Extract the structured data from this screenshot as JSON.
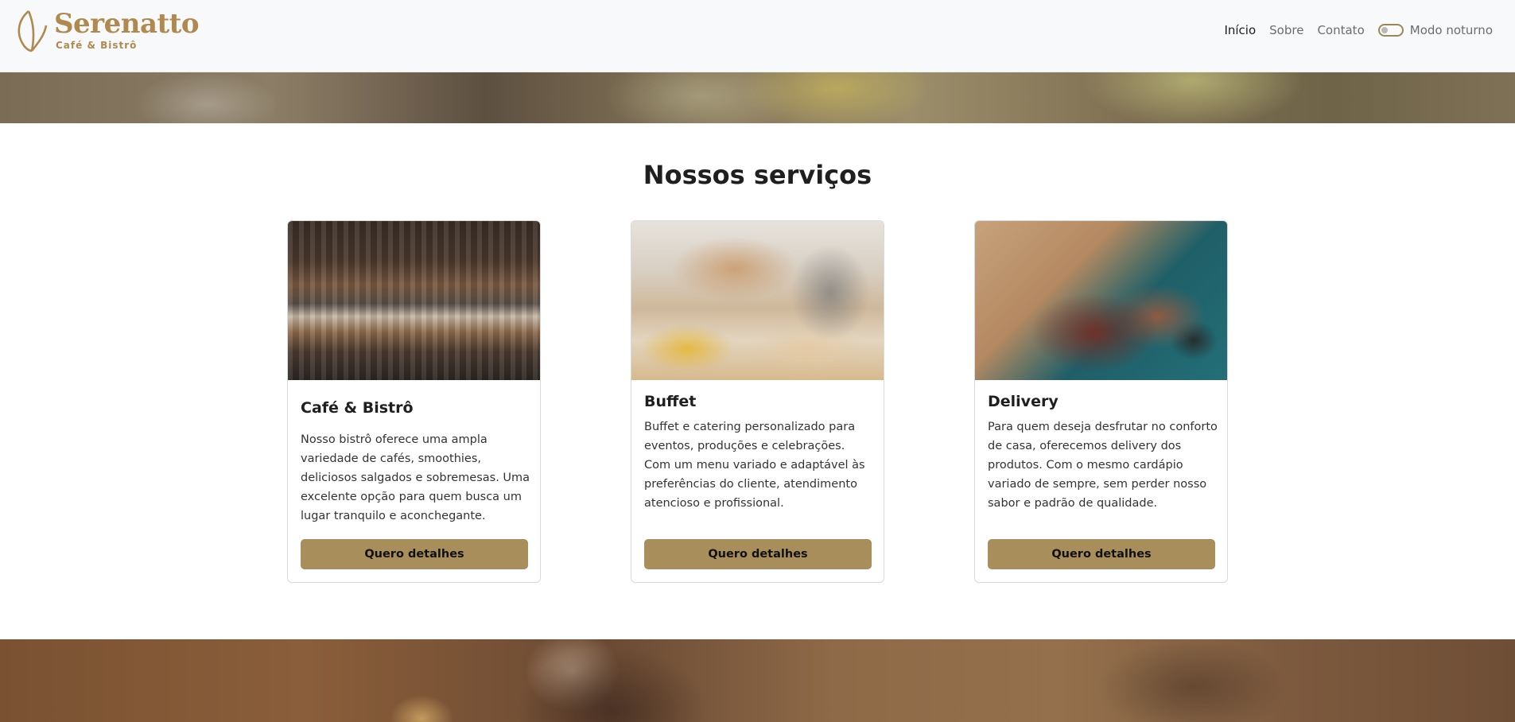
{
  "brand": {
    "name": "Serenatto",
    "subtitle": "Café & Bistrô",
    "color": "#b0894f"
  },
  "nav": {
    "items": [
      {
        "label": "Início",
        "active": true
      },
      {
        "label": "Sobre",
        "active": false
      },
      {
        "label": "Contato",
        "active": false
      }
    ],
    "dark_mode_label": "Modo noturno",
    "dark_mode_on": false
  },
  "services": {
    "title": "Nossos serviços",
    "button_color": "#a88e5a",
    "cards": [
      {
        "title": "Café & Bistrô",
        "text": "Nosso bistrô oferece uma ampla variedade de cafés, smoothies, deliciosos salgados e sobremesas. Uma excelente opção para quem busca um lugar tranquilo e aconchegante.",
        "button": "Quero detalhes"
      },
      {
        "title": "Buffet",
        "text": "Buffet e catering personalizado para eventos, produções e celebrações. Com um menu variado e adaptável às preferências do cliente, atendimento atencioso e profissional.",
        "button": "Quero detalhes"
      },
      {
        "title": "Delivery",
        "text": "Para quem deseja desfrutar no conforto de casa, oferecemos delivery dos produtos. Com o mesmo cardápio variado de sempre, sem perder nosso sabor e padrão de qualidade.",
        "button": "Quero detalhes"
      }
    ]
  }
}
